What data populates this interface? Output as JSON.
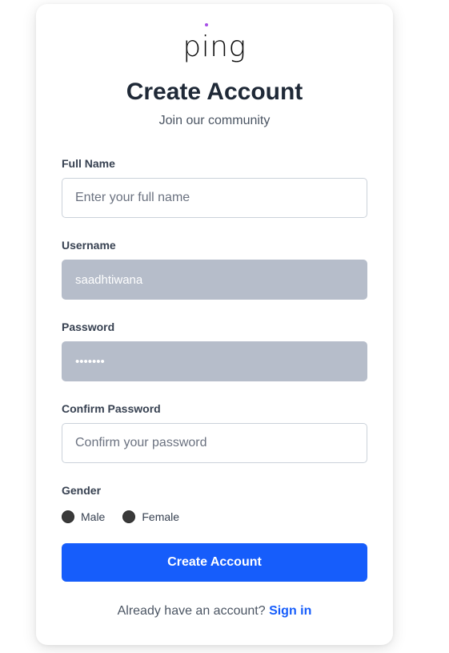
{
  "brand": {
    "logo_text": "ping",
    "dot_color": "#a64ee6"
  },
  "header": {
    "title": "Create Account",
    "subtitle": "Join our community"
  },
  "form": {
    "full_name": {
      "label": "Full Name",
      "placeholder": "Enter your full name",
      "value": ""
    },
    "username": {
      "label": "Username",
      "value": "saadhtiwana"
    },
    "password": {
      "label": "Password",
      "value": "•••••••"
    },
    "confirm_password": {
      "label": "Confirm Password",
      "placeholder": "Confirm your password",
      "value": ""
    },
    "gender": {
      "label": "Gender",
      "options": [
        "Male",
        "Female"
      ]
    },
    "submit_label": "Create Account"
  },
  "footer": {
    "prompt": "Already have an account?",
    "link_label": "Sign in"
  },
  "colors": {
    "primary": "#165dfb",
    "autofill_bg": "#b6bdca"
  }
}
